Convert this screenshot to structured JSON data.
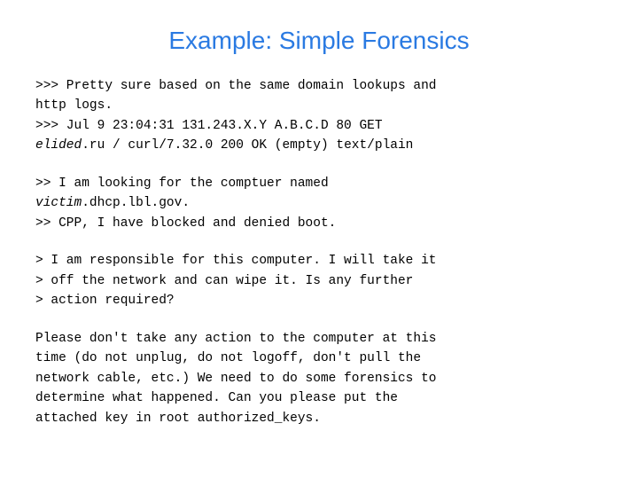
{
  "page": {
    "title": "Example: Simple Forensics",
    "title_color": "#2a7ae2"
  },
  "content": {
    "block1_line1": ">>> Pretty sure based on the same domain lookups and",
    "block1_line2": "http logs.",
    "block1_line3": ">>> Jul  9 23:04:31 131.243.X.Y A.B.C.D 80 GET",
    "block1_line4_italic": "elided",
    "block1_line4_rest": ".ru / curl/7.32.0 200 OK (empty) text/plain",
    "block2_line1": ">> I am looking for the comptuer named",
    "block2_line2_italic": "victim",
    "block2_line2_rest": ".dhcp.lbl.gov.",
    "block2_line3": ">> CPP, I have blocked and denied boot.",
    "block3_line1": "> I am responsible for this computer. I will take it",
    "block3_line2": "> off the network and can wipe it. Is any further",
    "block3_line3": "> action required?",
    "block4_line1": "Please don't take any action to the computer at this",
    "block4_line2": "time (do not unplug, do not logoff, don't pull the",
    "block4_line3": "network cable, etc.) We need to do some forensics to",
    "block4_line4": "determine what happened. Can you please put the",
    "block4_line5": "attached key in root authorized_keys."
  }
}
